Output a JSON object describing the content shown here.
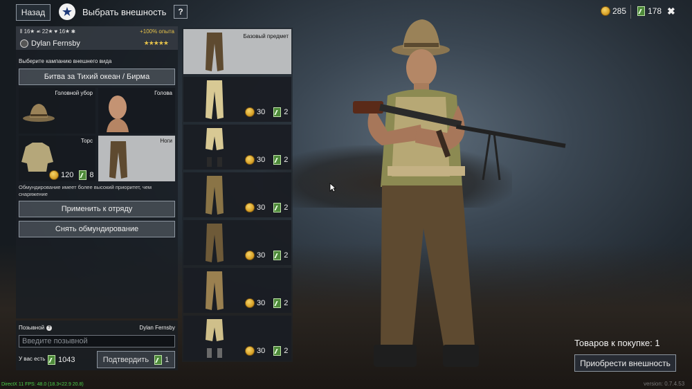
{
  "header": {
    "back_label": "Назад",
    "title": "Выбрать внешность",
    "help_label": "?",
    "silver": "285",
    "tickets": "178",
    "close_label": "✖"
  },
  "soldier": {
    "stat1": "16",
    "stat2": "22",
    "stat3": "16",
    "xp_bonus": "+100% опыта",
    "name": "Dylan Fernsby",
    "rating": "★★★★★"
  },
  "appearance": {
    "campaign_prompt": "Выберите кампанию внешнего вида",
    "campaign_label": "Битва за Тихий океан / Бирма",
    "slots": [
      {
        "label": "Головной убор"
      },
      {
        "label": "Голова"
      },
      {
        "label": "Торс",
        "price_silver": "120",
        "price_tickets": "8"
      },
      {
        "label": "Ноги"
      }
    ],
    "priority_note": "Обмундирование имеет более высокий приоритет, чем снаряжение",
    "apply_label": "Применить к отряду",
    "remove_label": "Снять обмундирование"
  },
  "callsign": {
    "label": "Позывной",
    "qmark": "?",
    "name": "Dylan Fernsby",
    "placeholder": "Введите позывной",
    "have_label": "У вас есть",
    "have_value": "1043",
    "confirm_label": "Подтвердить",
    "confirm_tickets": "1"
  },
  "items": [
    {
      "title": "Базовый предмет",
      "selected": true
    },
    {
      "silver": "30",
      "tickets": "2"
    },
    {
      "silver": "30",
      "tickets": "2"
    },
    {
      "silver": "30",
      "tickets": "2"
    },
    {
      "silver": "30",
      "tickets": "2"
    },
    {
      "silver": "30",
      "tickets": "2"
    },
    {
      "silver": "30",
      "tickets": "2"
    }
  ],
  "cart": {
    "count_label": "Товаров к покупке: 1",
    "buy_label": "Приобрести внешность"
  },
  "footer": {
    "version": "version: 0.7.4.53",
    "fps": "DirectX 11 FPS: 48.0 (18.3<22.9 20.8)"
  },
  "colors": {
    "accent_gold": "#e6c24a",
    "ticket_green": "#4e8a3a",
    "selected_bg": "#b9bbbd"
  }
}
